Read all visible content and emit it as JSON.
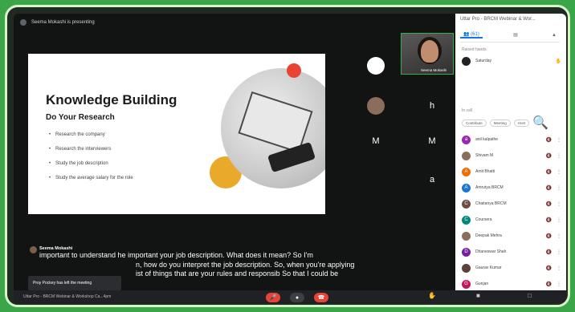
{
  "window": {
    "top_text": "Seema Mokashi is presenting",
    "panel_title": "Uttar Pro - BRCM Webinar & Wor..."
  },
  "slide": {
    "title": "Knowledge Building",
    "subtitle": "Do Your Research",
    "bullets": [
      "Research the company",
      "Research the interviewers",
      "Study the job description",
      "Study the average salary for the role"
    ]
  },
  "tiles": [
    {
      "letter": "",
      "color": "#ffffff"
    },
    {
      "letter": "h",
      "color": "#c2185b"
    },
    {
      "letter": "M",
      "color": "#8d4a42"
    },
    {
      "letter": "M",
      "color": "#2e7d32"
    },
    {
      "letter": "",
      "color": "#b06a2b"
    },
    {
      "letter": "a",
      "color": "#5f7a8c"
    },
    {
      "letter": "",
      "color": "#5b3a2e"
    },
    {
      "letter": "",
      "color": "#666666"
    }
  ],
  "video": {
    "name": "Seema Mokashi"
  },
  "panel": {
    "tabs": [
      "(61)",
      "chat",
      "activities"
    ],
    "section_raised": "Raised hands",
    "raised": [
      {
        "name": "Saturday",
        "color": "#222222"
      }
    ],
    "section_in_call": "In call",
    "chips": [
      "Contribute",
      "Meeting",
      "Host"
    ],
    "people": [
      {
        "name": "anil kalpathe",
        "color": "#9c27b0",
        "initial": "a"
      },
      {
        "name": "Shivam M",
        "color": "#8a6d5a",
        "initial": ""
      },
      {
        "name": "Amit Bhatti",
        "color": "#ef6c00",
        "initial": "A"
      },
      {
        "name": "Amrutya BRCM",
        "color": "#1976d2",
        "initial": "A"
      },
      {
        "name": "Chaitanya BRCM",
        "color": "#6d4c41",
        "initial": "C"
      },
      {
        "name": "Coursera",
        "color": "#00897b",
        "initial": "C"
      },
      {
        "name": "Deepak Mehra",
        "color": "#8a6d5a",
        "initial": ""
      },
      {
        "name": "Dhaneswar Shah",
        "color": "#7b1fa2",
        "initial": "D"
      },
      {
        "name": "Gaurav Kumar",
        "color": "#5d4037",
        "initial": ""
      },
      {
        "name": "Gunjan",
        "color": "#c2185b",
        "initial": "G"
      }
    ]
  },
  "caption": {
    "speaker": "Seema Mokashi",
    "lines": [
      "important to understand he important your job description. What does it mean? So I'm",
      "n, how do you interpret the job description. So, when you're applying",
      "ist of things that are your rules and responsib So that I could be"
    ]
  },
  "toast": "Proy Pockey has left the meeting",
  "bottom": {
    "meeting_name": "Uttar Pro - BRCM Webinar & Workshop Ca...4pm",
    "buttons": [
      "mic-off",
      "cam",
      "end"
    ]
  }
}
